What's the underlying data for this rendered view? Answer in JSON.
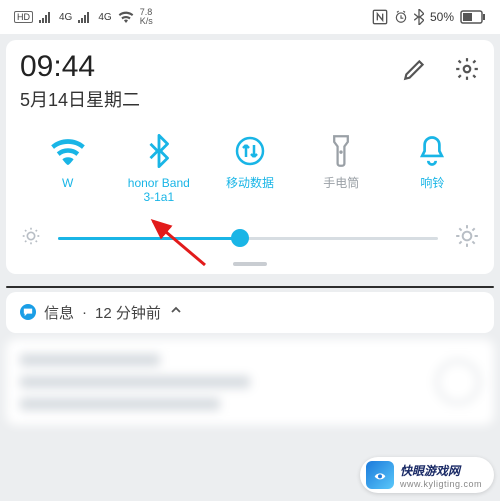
{
  "status": {
    "hd_label": "HD",
    "net_label": "4G",
    "speed_top": "7.8",
    "speed_bottom": "K/s",
    "battery": "50%"
  },
  "header": {
    "time": "09:44",
    "date": "5月14日星期二"
  },
  "toggles": {
    "wifi": {
      "label": "W"
    },
    "bluetooth": {
      "label": "honor Band\n3-1a1"
    },
    "mobiledata": {
      "label": "移动数据"
    },
    "flashlight": {
      "label": "手电筒"
    },
    "ringer": {
      "label": "响铃"
    }
  },
  "brightness": {
    "percent": 48
  },
  "notification": {
    "app": "信息",
    "sep": " · ",
    "time": "12 分钟前"
  },
  "watermark": {
    "title": "快眼游戏网",
    "sub": "www.kyligting.com"
  }
}
